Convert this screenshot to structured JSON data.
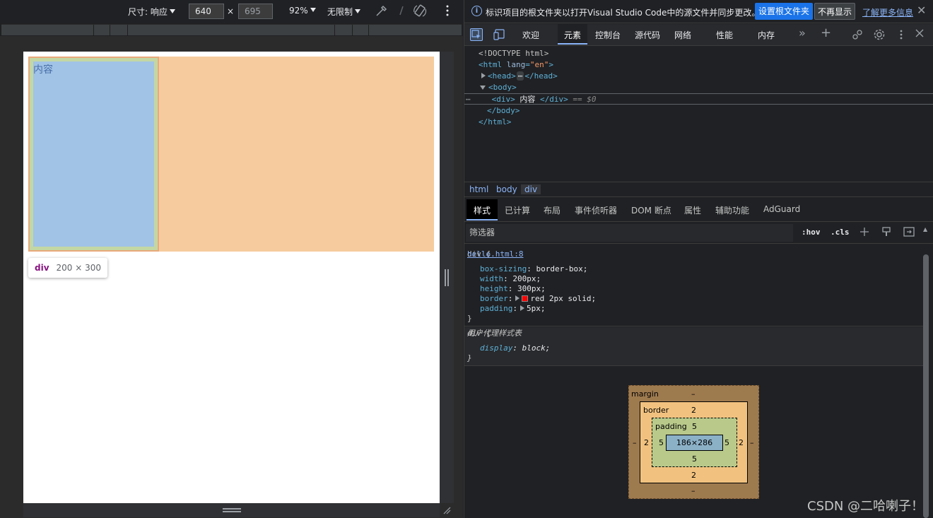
{
  "device_toolbar": {
    "dimensions_label": "尺寸: 响应",
    "width_value": "640",
    "times": "×",
    "height_placeholder": "695",
    "zoom": "92%",
    "throttle": "无限制"
  },
  "page_content": {
    "div_text": "内容",
    "tooltip_tag": "div",
    "tooltip_size": "200 × 300"
  },
  "infobar": {
    "message": "标识项目的根文件夹以打开Visual Studio Code中的源文件并同步更改。",
    "set_root_button": "设置根文件夹",
    "dont_show_button": "不再显示",
    "learn_more_link": "了解更多信息",
    "close": "✕"
  },
  "tabs": {
    "welcome": "欢迎",
    "elements": "元素",
    "console": "控制台",
    "sources": "源代码",
    "network": "网络",
    "performance": "性能",
    "memory": "内存",
    "more": "»",
    "add": "+"
  },
  "dom": {
    "doctype": "<!DOCTYPE html>",
    "html_open_tag": "<html",
    "html_attr": "lang",
    "html_attr_eq": "=",
    "html_attr_val": "\"en\"",
    "html_close_bracket": ">",
    "head_open": "<head>",
    "head_dots": "⋯",
    "head_close": "</head>",
    "body_open": "<body>",
    "div_open": "<div>",
    "div_text": " 内容 ",
    "div_close": "</div>",
    "div_eq": " == $0",
    "body_close": "</body>",
    "html_close": "</html>",
    "line_dots": "⋯"
  },
  "breadcrumbs": [
    "html",
    "body",
    "div"
  ],
  "style_tabs": {
    "styles": "样式",
    "computed": "已计算",
    "layout": "布局",
    "event_listeners": "事件侦听器",
    "dom_breakpoints": "DOM 断点",
    "properties": "属性",
    "accessibility": "辅助功能",
    "adguard": "AdGuard"
  },
  "filter": {
    "placeholder": "筛选器",
    "hov": ":hov",
    "cls": ".cls"
  },
  "rule1": {
    "selector": "div {",
    "source": "hello.html:8",
    "declarations": [
      {
        "name": "box-sizing",
        "value": "border-box;"
      },
      {
        "name": "width",
        "value": "200px;"
      },
      {
        "name": "height",
        "value": "300px;"
      },
      {
        "name": "border",
        "value": "red 2px solid;"
      },
      {
        "name": "padding",
        "value": "5px;"
      }
    ],
    "close": "}"
  },
  "rule2": {
    "selector": "div {",
    "source": "用户代理样式表",
    "declarations": [
      {
        "name": "display",
        "value": "block;"
      }
    ],
    "close": "}"
  },
  "box_model": {
    "margin_label": "margin",
    "margin_value": "–",
    "border_label": "border",
    "border_value": "2",
    "padding_label": "padding",
    "padding_value": "5",
    "content": "186×286",
    "side_dash": "–",
    "border_side": "2",
    "padding_side": "5"
  },
  "watermark": "CSDN @二哈喇子！"
}
